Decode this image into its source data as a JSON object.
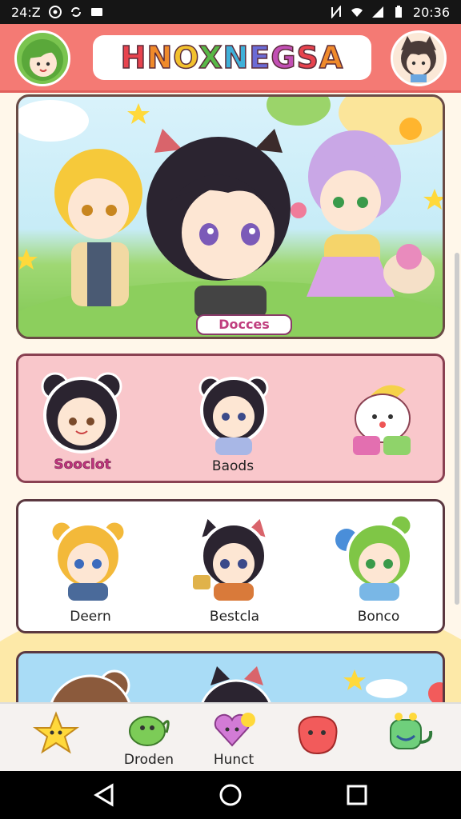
{
  "status_bar": {
    "time_left": "24:Z",
    "time_right": "20:36"
  },
  "header": {
    "title": "HNOXNEGSA",
    "title_colors": [
      "#e8434e",
      "#f08a2b",
      "#f2c12e",
      "#58b847",
      "#3fb0d9",
      "#6b6bd6",
      "#c24fb5",
      "#e8434e",
      "#f08a2b"
    ],
    "left_avatar_icon": "green-haired-avatar-icon",
    "right_avatar_icon": "cat-ear-profile-avatar-icon"
  },
  "hero": {
    "label": "Docces"
  },
  "cards": {
    "pink": {
      "items": [
        {
          "caption": "Sooclot",
          "icon": "bear-ear-girl-sticker"
        },
        {
          "caption": "Baods",
          "icon": "black-haired-boy-sticker"
        },
        {
          "caption": "",
          "icon": "white-blob-mascot-sticker"
        }
      ]
    },
    "white": {
      "items": [
        {
          "caption": "Deern",
          "icon": "blonde-bear-girl-sticker"
        },
        {
          "caption": "Bestcla",
          "icon": "cat-ear-girl-sticker"
        },
        {
          "caption": "Bonco",
          "icon": "green-haired-girl-sticker"
        }
      ]
    }
  },
  "bottom_nav": {
    "items": [
      {
        "label": "",
        "icon": "star-icon",
        "color": "#ffd93b"
      },
      {
        "label": "Droden",
        "icon": "green-frog-icon",
        "color": "#7ccc57"
      },
      {
        "label": "Hunct",
        "icon": "heart-balloon-icon",
        "color": "#d27bd6"
      },
      {
        "label": "",
        "icon": "red-blob-icon",
        "color": "#f25b5b"
      },
      {
        "label": "",
        "icon": "green-dino-icon",
        "color": "#6fcf7c"
      }
    ]
  }
}
